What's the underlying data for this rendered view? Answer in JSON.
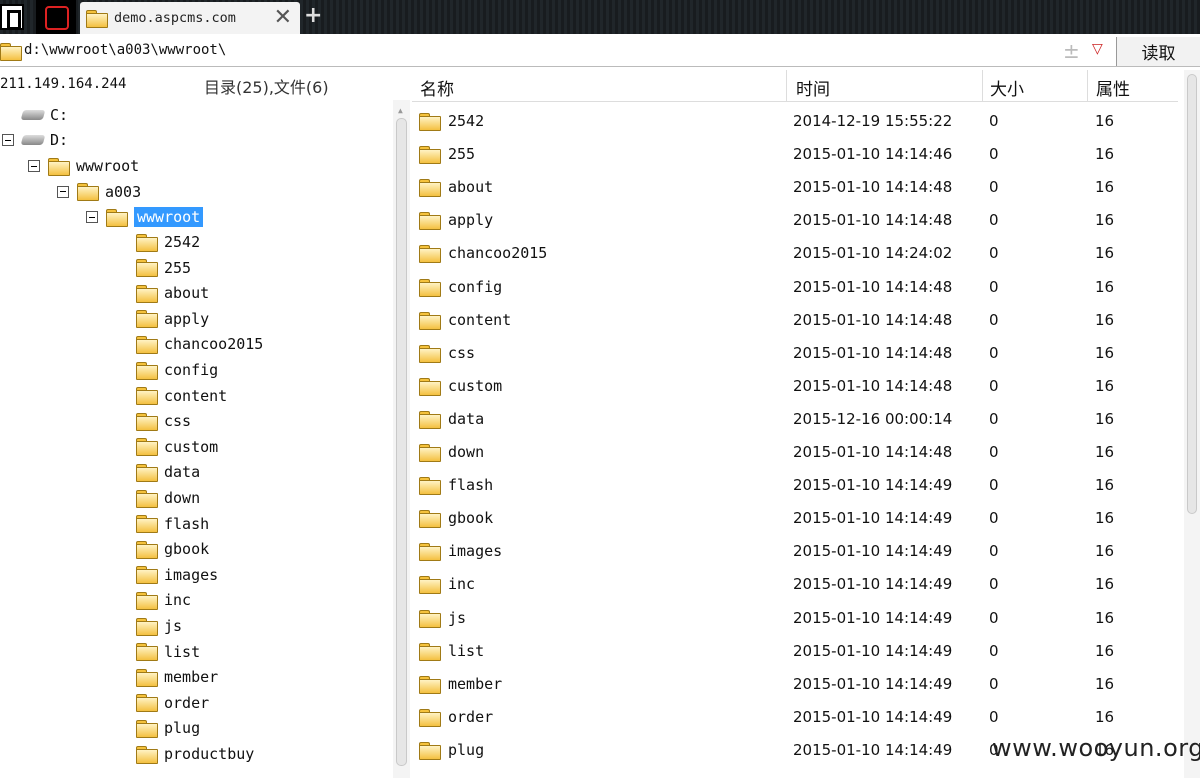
{
  "tab": {
    "title": "demo.aspcms.com",
    "close": "✕",
    "new": "+"
  },
  "address": {
    "path": "d:\\wwwroot\\a003\\wwwroot\\",
    "read_label": "读取",
    "plus": "±",
    "caret": "▽"
  },
  "server": {
    "ip": "211.149.164.244",
    "count": "目录(25),文件(6)"
  },
  "tree": {
    "drives": [
      "C:",
      "D:"
    ],
    "path": [
      "wwwroot",
      "a003",
      "wwwroot"
    ],
    "children": [
      "2542",
      "255",
      "about",
      "apply",
      "chancoo2015",
      "config",
      "content",
      "css",
      "custom",
      "data",
      "down",
      "flash",
      "gbook",
      "images",
      "inc",
      "js",
      "list",
      "member",
      "order",
      "plug",
      "productbuy"
    ]
  },
  "columns": {
    "name": "名称",
    "time": "时间",
    "size": "大小",
    "attr": "属性"
  },
  "files": [
    {
      "name": "2542",
      "time": "2014-12-19 15:55:22",
      "size": "0",
      "attr": "16"
    },
    {
      "name": "255",
      "time": "2015-01-10 14:14:46",
      "size": "0",
      "attr": "16"
    },
    {
      "name": "about",
      "time": "2015-01-10 14:14:48",
      "size": "0",
      "attr": "16"
    },
    {
      "name": "apply",
      "time": "2015-01-10 14:14:48",
      "size": "0",
      "attr": "16"
    },
    {
      "name": "chancoo2015",
      "time": "2015-01-10 14:24:02",
      "size": "0",
      "attr": "16"
    },
    {
      "name": "config",
      "time": "2015-01-10 14:14:48",
      "size": "0",
      "attr": "16"
    },
    {
      "name": "content",
      "time": "2015-01-10 14:14:48",
      "size": "0",
      "attr": "16"
    },
    {
      "name": "css",
      "time": "2015-01-10 14:14:48",
      "size": "0",
      "attr": "16"
    },
    {
      "name": "custom",
      "time": "2015-01-10 14:14:48",
      "size": "0",
      "attr": "16"
    },
    {
      "name": "data",
      "time": "2015-12-16 00:00:14",
      "size": "0",
      "attr": "16"
    },
    {
      "name": "down",
      "time": "2015-01-10 14:14:48",
      "size": "0",
      "attr": "16"
    },
    {
      "name": "flash",
      "time": "2015-01-10 14:14:49",
      "size": "0",
      "attr": "16"
    },
    {
      "name": "gbook",
      "time": "2015-01-10 14:14:49",
      "size": "0",
      "attr": "16"
    },
    {
      "name": "images",
      "time": "2015-01-10 14:14:49",
      "size": "0",
      "attr": "16"
    },
    {
      "name": "inc",
      "time": "2015-01-10 14:14:49",
      "size": "0",
      "attr": "16"
    },
    {
      "name": "js",
      "time": "2015-01-10 14:14:49",
      "size": "0",
      "attr": "16"
    },
    {
      "name": "list",
      "time": "2015-01-10 14:14:49",
      "size": "0",
      "attr": "16"
    },
    {
      "name": "member",
      "time": "2015-01-10 14:14:49",
      "size": "0",
      "attr": "16"
    },
    {
      "name": "order",
      "time": "2015-01-10 14:14:49",
      "size": "0",
      "attr": "16"
    },
    {
      "name": "plug",
      "time": "2015-01-10 14:14:49",
      "size": "0",
      "attr": "16"
    }
  ],
  "watermark": "www.wooyun.org"
}
